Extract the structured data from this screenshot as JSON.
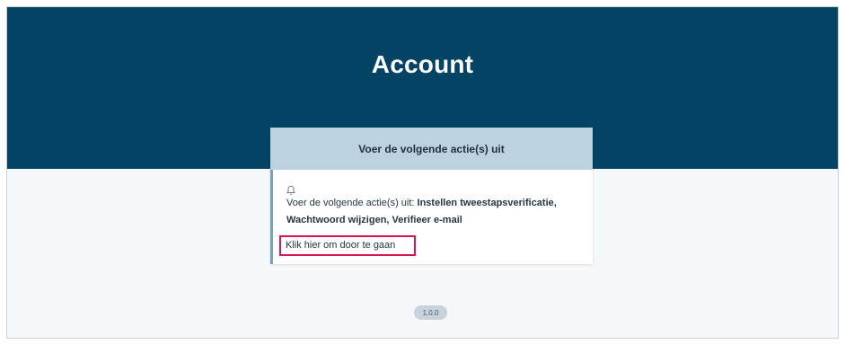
{
  "header": {
    "title": "Account"
  },
  "card": {
    "title": "Voer de volgende actie(s) uit",
    "message_prefix": "Voer de volgende actie(s) uit: ",
    "message_actions": "Instellen tweestapsverificatie, Wachtwoord wijzigen, Verifieer e-mail",
    "continue_link": "Klik hier om door te gaan",
    "icon": "bell-icon"
  },
  "footer": {
    "version": "1.0.0"
  },
  "colors": {
    "banner": "#034364",
    "card_header": "#bcd2e0",
    "highlight": "#d6164f"
  }
}
